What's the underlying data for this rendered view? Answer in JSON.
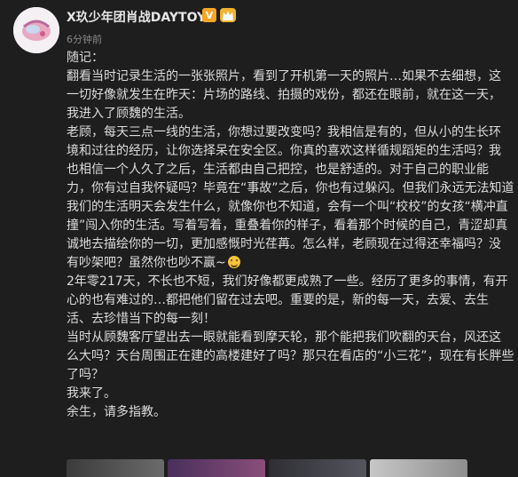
{
  "user": {
    "name": "X玖少年团肖战DAYTOY",
    "verified_label": "V",
    "time": "6分钟前"
  },
  "post": {
    "lines": [
      "随记：",
      "翻看当时记录生活的一张张照片，看到了开机第一天的照片…如果不去细想，这",
      "一切好像就发生在昨天：片场的路线、拍摄的戏份，都还在眼前，就在这一天，",
      "我进入了顾魏的生活。",
      "老顾，每天三点一线的生活，你想过要改变吗？我相信是有的，但从小的生长环",
      "境和过往的经历，让你选择呆在安全区。你真的喜欢这样循规蹈矩的生活吗？我",
      "也相信一个人久了之后，生活都由自己把控，也是舒适的。对于自己的职业能",
      "力，你有过自我怀疑吗？毕竟在“事故”之后，你也有过躲闪。但我们永远无法知道",
      "我们的生活明天会发生什么，就像你也不知道，会有一个叫“校校”的女孩“横冲直",
      "撞”闯入你的生活。写着写着，重叠着你的样子，看着那个时候的自己，青涩却真",
      "诚地去描绘你的一切，更加感慨时光荏苒。怎么样，老顾现在过得还幸福吗？没",
      "有吵架吧？虽然你也吵不赢~",
      "2年零217天，不长也不短，我们好像都更成熟了一些。经历了更多的事情，有开",
      "心的也有难过的…都把他们留在过去吧。重要的是，新的每一天，去爱、去生",
      "活、去珍惜当下的每一刻！",
      "当时从顾魏客厅望出去一眼就能看到摩天轮，那个能把我们吹翻的天台，风还这",
      "么大吗？天台周围正在建的高楼建好了吗？那只在看店的“小三花”，现在有长胖些",
      "了吗？",
      "我来了。",
      "余生，请多指教。"
    ]
  },
  "colors": {
    "background": "#1e1e1e",
    "text": "#dcdcdc",
    "meta": "#8a8a8a",
    "badge": "#f5a623"
  }
}
